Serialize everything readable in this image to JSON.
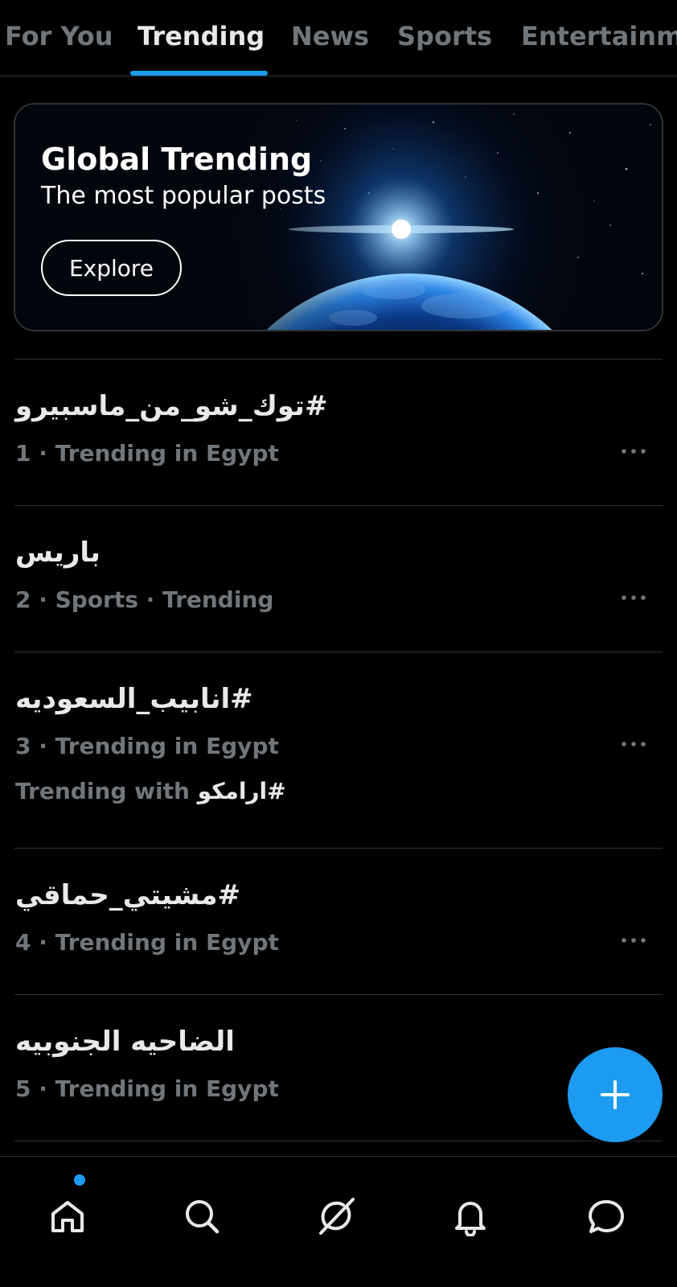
{
  "tabs": [
    {
      "label": "For You",
      "active": false
    },
    {
      "label": "Trending",
      "active": true
    },
    {
      "label": "News",
      "active": false
    },
    {
      "label": "Sports",
      "active": false
    },
    {
      "label": "Entertainm",
      "active": false
    }
  ],
  "banner": {
    "title": "Global Trending",
    "subtitle": "The most popular posts",
    "button_label": "Explore"
  },
  "trends": [
    {
      "name": "#توك_شو_من_ماسبيرو",
      "meta": "1 · Trending in Egypt"
    },
    {
      "name": "باريس",
      "meta": "2 · Sports · Trending"
    },
    {
      "name": "#انابيب_السعوديه",
      "meta": "3 · Trending in Egypt",
      "with_label": "Trending with",
      "with_tag": "#ارامكو"
    },
    {
      "name": "#مشيتي_حماقي",
      "meta": "4 · Trending in Egypt"
    },
    {
      "name": "الضاحيه الجنوبيه",
      "meta": "5 · Trending in Egypt"
    }
  ],
  "bottom_nav": [
    {
      "icon": "home-icon",
      "notification_dot": true
    },
    {
      "icon": "search-icon"
    },
    {
      "icon": "grok-icon"
    },
    {
      "icon": "bell-icon"
    },
    {
      "icon": "chat-bubble-icon"
    }
  ],
  "colors": {
    "accent": "#1d9bf0",
    "background": "#000000",
    "text_primary": "#e7e9ea",
    "text_secondary": "#71767b",
    "divider": "#2f3336"
  }
}
